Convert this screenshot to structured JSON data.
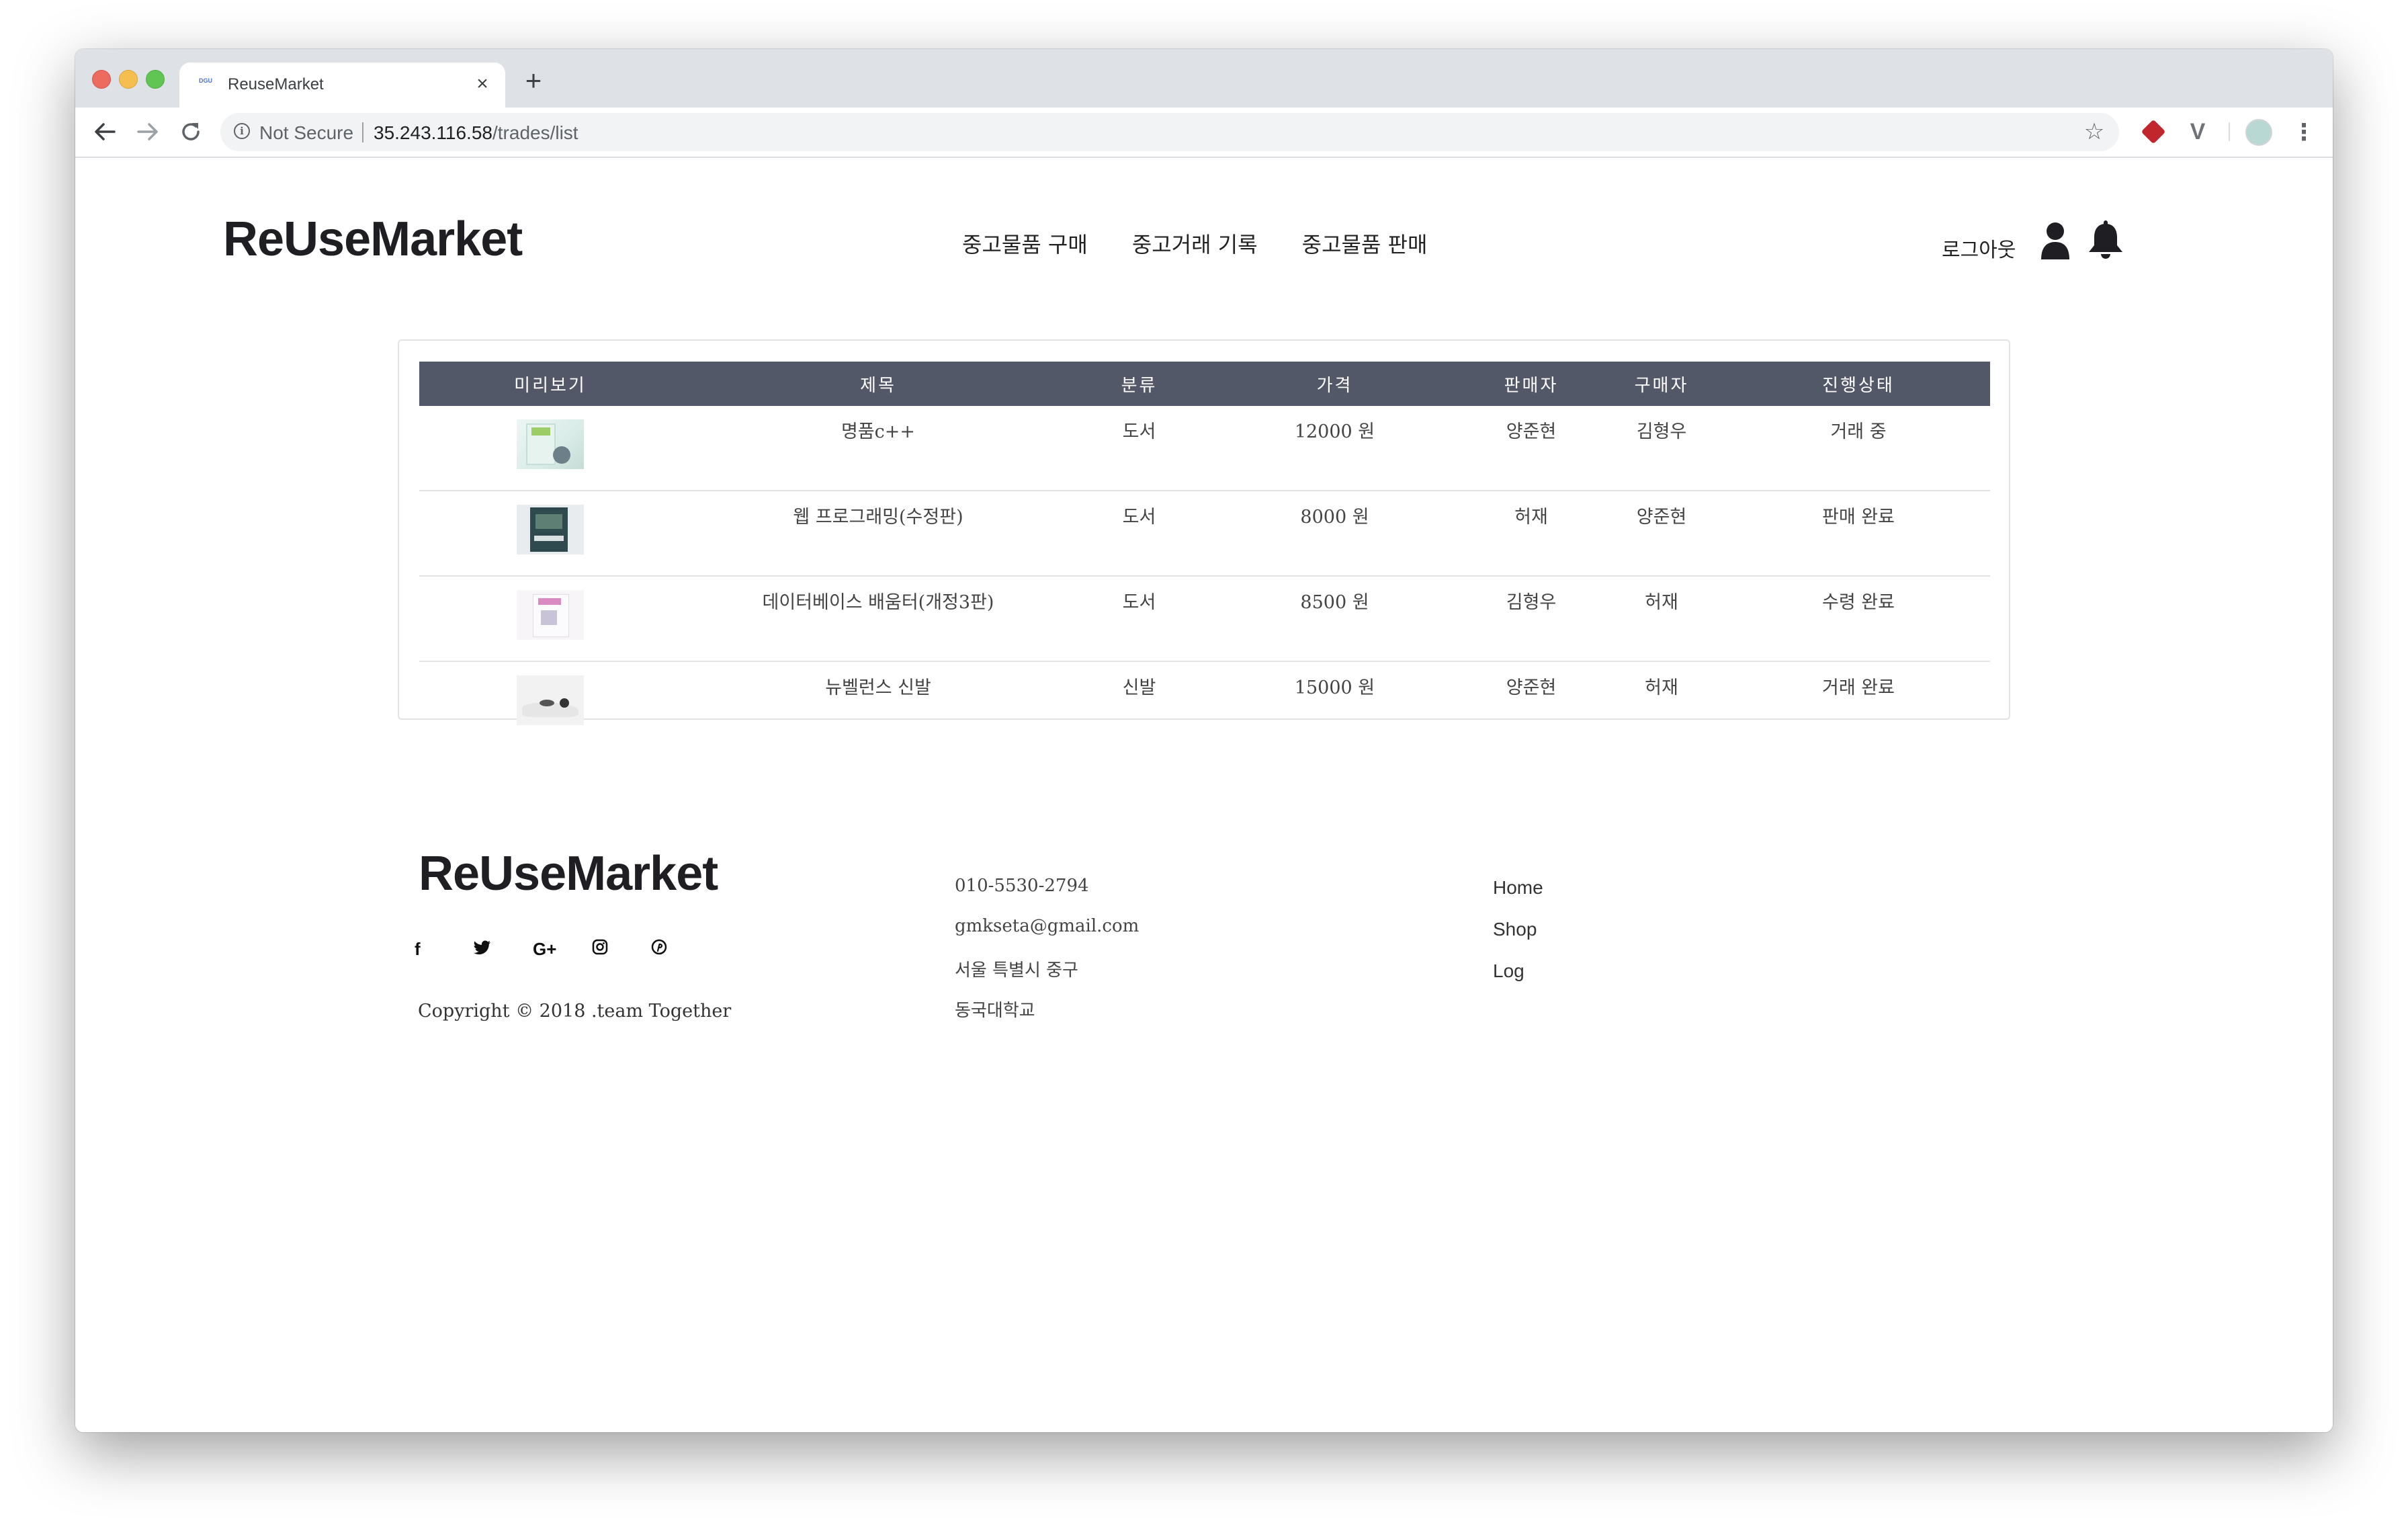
{
  "browser": {
    "tab_title": "ReuseMarket",
    "favicon_text": "DGU",
    "new_tab": "+",
    "close_tab": "×",
    "security_label": "Not Secure",
    "url_host": "35.243.116.58",
    "url_path": "/trades/list"
  },
  "header": {
    "logo": "ReUseMarket",
    "nav": [
      "중고물품 구매",
      "중고거래 기록",
      "중고물품 판매"
    ],
    "logout": "로그아웃"
  },
  "table": {
    "columns": [
      "미리보기",
      "제목",
      "분류",
      "가격",
      "판매자",
      "구매자",
      "진행상태"
    ],
    "rows": [
      {
        "title": "명품c++",
        "category": "도서",
        "price": "12000 원",
        "seller": "양준현",
        "buyer": "김형우",
        "status": "거래 중"
      },
      {
        "title": "웹 프로그래밍(수정판)",
        "category": "도서",
        "price": "8000 원",
        "seller": "허재",
        "buyer": "양준현",
        "status": "판매 완료"
      },
      {
        "title": "데이터베이스 배움터(개정3판)",
        "category": "도서",
        "price": "8500 원",
        "seller": "김형우",
        "buyer": "허재",
        "status": "수령 완료"
      },
      {
        "title": "뉴벨런스 신발",
        "category": "신발",
        "price": "15000 원",
        "seller": "양준현",
        "buyer": "허재",
        "status": "거래 완료"
      }
    ]
  },
  "footer": {
    "logo": "ReUseMarket",
    "social": [
      {
        "icon": "facebook-icon",
        "glyph": "f"
      },
      {
        "icon": "twitter-icon",
        "glyph": "🐦"
      },
      {
        "icon": "google-plus-icon",
        "glyph": "G+"
      },
      {
        "icon": "instagram-icon",
        "glyph": "◎"
      },
      {
        "icon": "pinterest-icon",
        "glyph": "℗"
      }
    ],
    "copyright": "Copyright © 2018 .team Together",
    "phone": "010-5530-2794",
    "email": "gmkseta@gmail.com",
    "address": "서울 특별시 중구",
    "school": "동국대학교",
    "links": [
      "Home",
      "Shop",
      "Log"
    ]
  },
  "colors": {
    "table_header_bg": "#535868",
    "traffic_red": "#ed6a5e",
    "traffic_yellow": "#f5bf4f",
    "traffic_green": "#61c554"
  }
}
